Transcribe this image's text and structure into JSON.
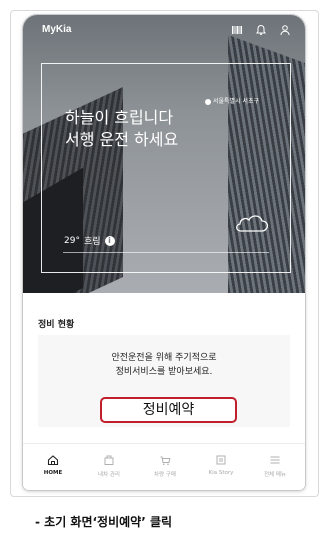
{
  "app": {
    "title": "MyKia"
  },
  "topbar": {
    "icons": [
      "barcode-icon",
      "bell-icon",
      "user-icon"
    ]
  },
  "hero": {
    "location": "서울특별시 서초구",
    "headline_line1": "하늘이 흐립니다",
    "headline_line2": "서행 운전 하세요",
    "temperature": "29°",
    "condition": "흐림",
    "weather_icon": "cloud-icon"
  },
  "maintenance": {
    "section_title": "정비 현황",
    "message_line1": "안전운전을 위해 주기적으로",
    "message_line2": "정비서비스를 받아보세요.",
    "reserve_button": "정비예약"
  },
  "nav": {
    "items": [
      {
        "label": "HOME",
        "icon": "home-icon",
        "active": true
      },
      {
        "label": "내차 관리",
        "icon": "car-manage-icon",
        "active": false
      },
      {
        "label": "차량 구매",
        "icon": "cart-icon",
        "active": false
      },
      {
        "label": "Kia Story",
        "icon": "story-icon",
        "active": false
      },
      {
        "label": "전체 메뉴",
        "icon": "menu-icon",
        "active": false
      }
    ]
  },
  "caption": "- 초기 화면‘정비예약’ 클릭",
  "colors": {
    "accent_red": "#c21f2c",
    "hero_gray": "#8d9296"
  }
}
